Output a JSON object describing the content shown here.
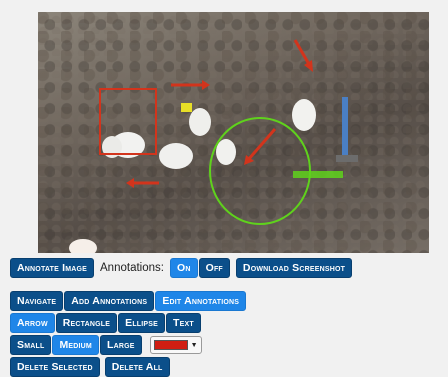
{
  "toolbar_main": {
    "annotate_image": "Annotate Image",
    "annotations_label": "Annotations:",
    "on": "On",
    "off": "Off",
    "download_screenshot": "Download Screenshot",
    "active_toggle": "On"
  },
  "modes": {
    "items": [
      "Navigate",
      "Add Annotations",
      "Edit Annotations"
    ],
    "active": "Edit Annotations"
  },
  "shapes": {
    "items": [
      "Arrow",
      "Rectangle",
      "Ellipse",
      "Text"
    ],
    "active": "Arrow"
  },
  "sizes": {
    "items": [
      "Small",
      "Medium",
      "Large"
    ],
    "active": "Medium"
  },
  "color": {
    "current": "#d01e12",
    "icon": "chevron-down-icon"
  },
  "actions": {
    "delete_selected": "Delete Selected",
    "delete_all": "Delete All"
  },
  "annotation_colors": {
    "red": "#d2341c",
    "green": "#5fd21c",
    "yellow": "#e8df27"
  }
}
